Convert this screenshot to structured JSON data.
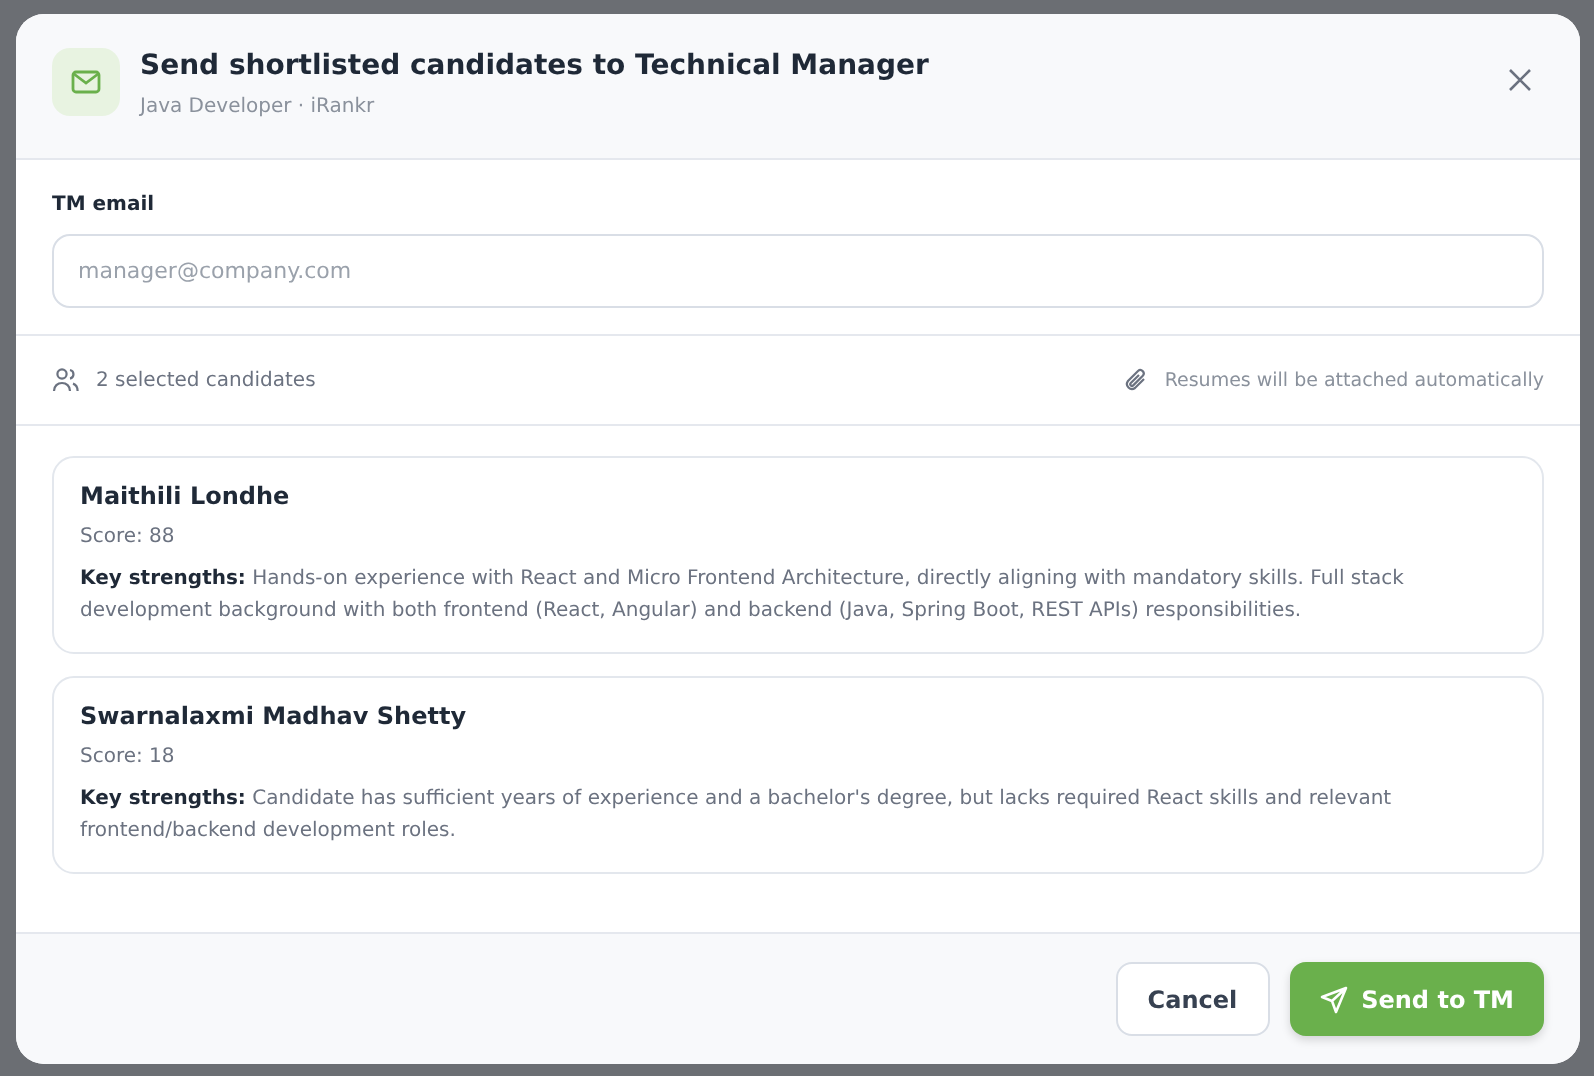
{
  "dialog": {
    "title": "Send shortlisted candidates to Technical Manager",
    "subtitle": "Java Developer · iRankr"
  },
  "email_field": {
    "label": "TM email",
    "placeholder": "manager@company.com"
  },
  "info_bar": {
    "selected_count": "2 selected candidates",
    "attachment_note": "Resumes will be attached automatically"
  },
  "candidates": [
    {
      "name": "Maithili Londhe",
      "score": "Score: 88",
      "strengths": "**Key strengths:** Hands-on experience with React and Micro Frontend Architecture, directly aligning with mandatory skills. Full stack development background with both frontend (React, Angular) and backend (Java, Spring Boot, REST APIs) responsibilities."
    },
    {
      "name": "Swarnalaxmi Madhav Shetty",
      "score": "Score: 18",
      "strengths": "**Key strengths:** Candidate has sufficient years of experience and a bachelor's degree, but lacks required React skills and relevant frontend/backend development roles."
    }
  ],
  "buttons": [
    {
      "label": "Cancel",
      "kind": "secondary"
    },
    {
      "label": "Send to TM",
      "kind": "primary"
    }
  ]
}
